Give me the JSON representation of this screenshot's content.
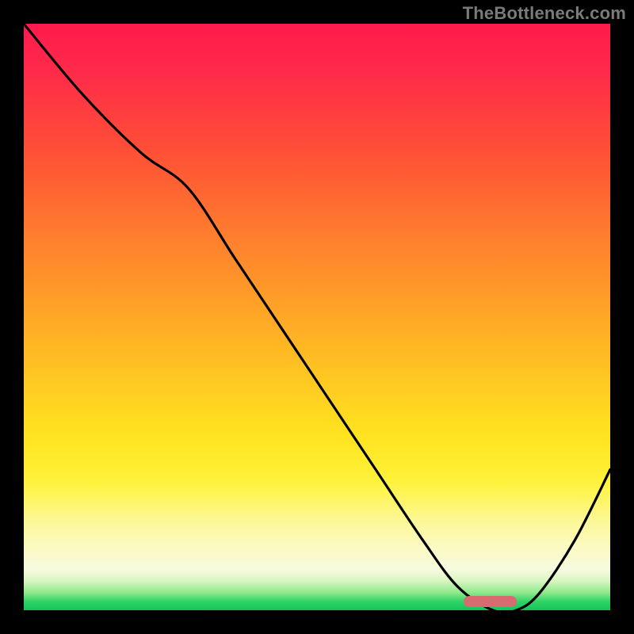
{
  "watermark": "TheBottleneck.com",
  "colors": {
    "background": "#000000",
    "curve": "#000000",
    "marker": "#d86b6f",
    "watermark_text": "#7a7a7a"
  },
  "chart_data": {
    "type": "line",
    "title": "",
    "xlabel": "",
    "ylabel": "",
    "xlim": [
      0,
      100
    ],
    "ylim": [
      0,
      100
    ],
    "series": [
      {
        "name": "bottleneck-curve",
        "x": [
          0,
          10,
          20,
          28,
          36,
          44,
          52,
          60,
          68,
          74,
          80,
          84,
          88,
          94,
          100
        ],
        "y": [
          100,
          88,
          78,
          72,
          60,
          48,
          36,
          24,
          12,
          4,
          0,
          0,
          3,
          12,
          24
        ]
      }
    ],
    "annotations": [
      {
        "name": "optimal-range-marker",
        "x_start": 75,
        "x_end": 84,
        "y": 1.5
      }
    ],
    "gradient_stops": [
      {
        "pos": 0,
        "color": "#ff1a4d"
      },
      {
        "pos": 50,
        "color": "#ffa127"
      },
      {
        "pos": 80,
        "color": "#fff23a"
      },
      {
        "pos": 100,
        "color": "#15c45a"
      }
    ]
  }
}
